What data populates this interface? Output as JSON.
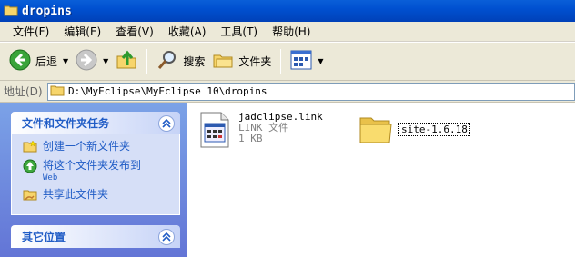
{
  "window": {
    "title": "dropins"
  },
  "menu": [
    "文件(F)",
    "编辑(E)",
    "查看(V)",
    "收藏(A)",
    "工具(T)",
    "帮助(H)"
  ],
  "toolbar": {
    "back": "后退",
    "search": "搜索",
    "folders": "文件夹"
  },
  "address": {
    "label": "地址(D)",
    "path": "D:\\MyEclipse\\MyEclipse 10\\dropins"
  },
  "tasks_panel": {
    "title": "文件和文件夹任务",
    "items": [
      {
        "label": "创建一个新文件夹",
        "icon": "new-folder-icon"
      },
      {
        "label": "将这个文件夹发布到",
        "sub": "Web",
        "icon": "publish-web-icon"
      },
      {
        "label": "共享此文件夹",
        "icon": "share-folder-icon"
      }
    ]
  },
  "places_panel": {
    "title": "其它位置"
  },
  "files": [
    {
      "name": "jadclipse.link",
      "type": "LINK 文件",
      "size": "1 KB",
      "icon": "link-file-icon"
    },
    {
      "name": "site-1.6.18",
      "icon": "folder-icon"
    }
  ],
  "colors": {
    "title_bar": "#0054e3",
    "pane_bg": "#6f8ddc",
    "link": "#215dc6"
  }
}
